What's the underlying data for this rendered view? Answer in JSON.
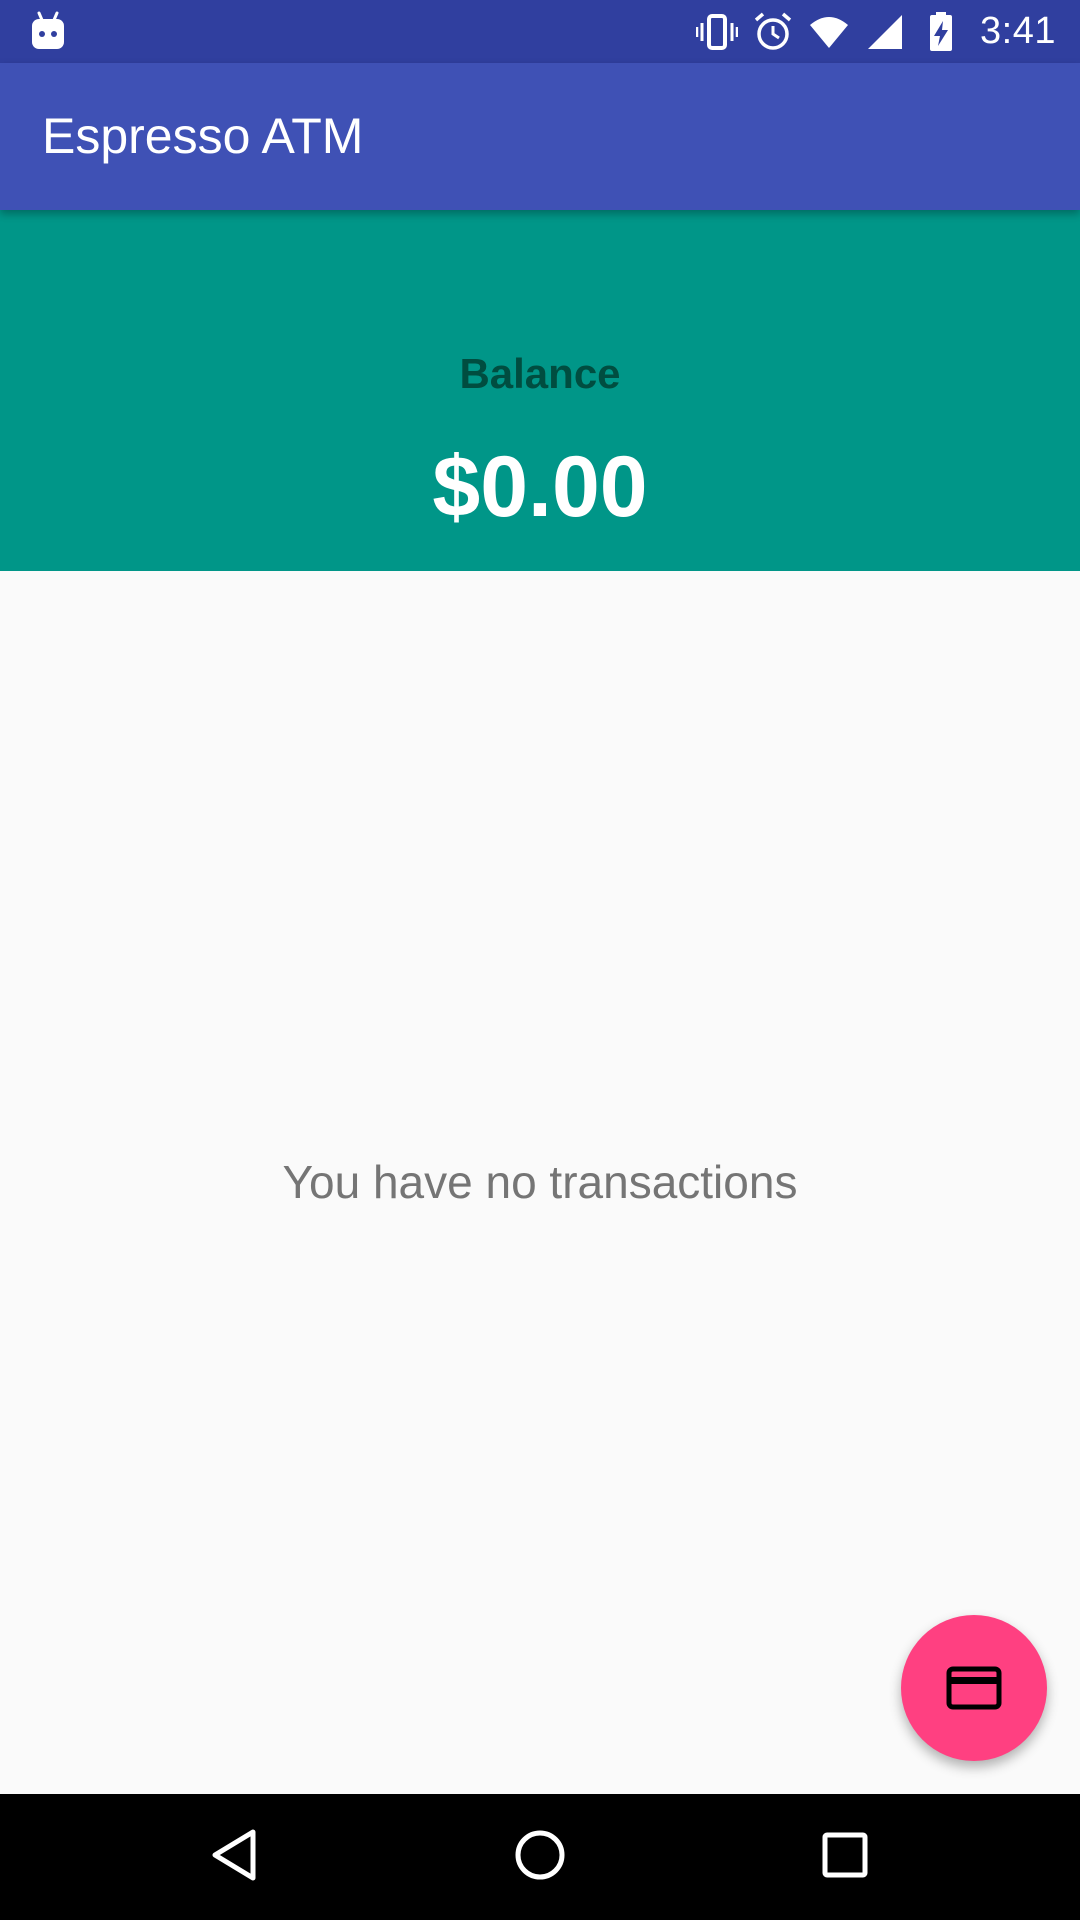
{
  "status_bar": {
    "time": "3:41",
    "background_color": "#303f9f",
    "icons": [
      "android-notification-icon",
      "vibrate-icon",
      "alarm-icon",
      "wifi-icon",
      "cell-signal-icon",
      "battery-charging-icon"
    ]
  },
  "app_bar": {
    "title": "Espresso ATM",
    "background_color": "#3f51b5"
  },
  "balance": {
    "label": "Balance",
    "amount": "$0.00",
    "background_color": "#009688",
    "label_color": "#004d40"
  },
  "transactions": {
    "empty_message": "You have no transactions"
  },
  "fab": {
    "icon": "credit-card-icon",
    "color": "#ff4081"
  },
  "nav_bar": {
    "icons": [
      "back-icon",
      "home-icon",
      "recents-icon"
    ]
  }
}
